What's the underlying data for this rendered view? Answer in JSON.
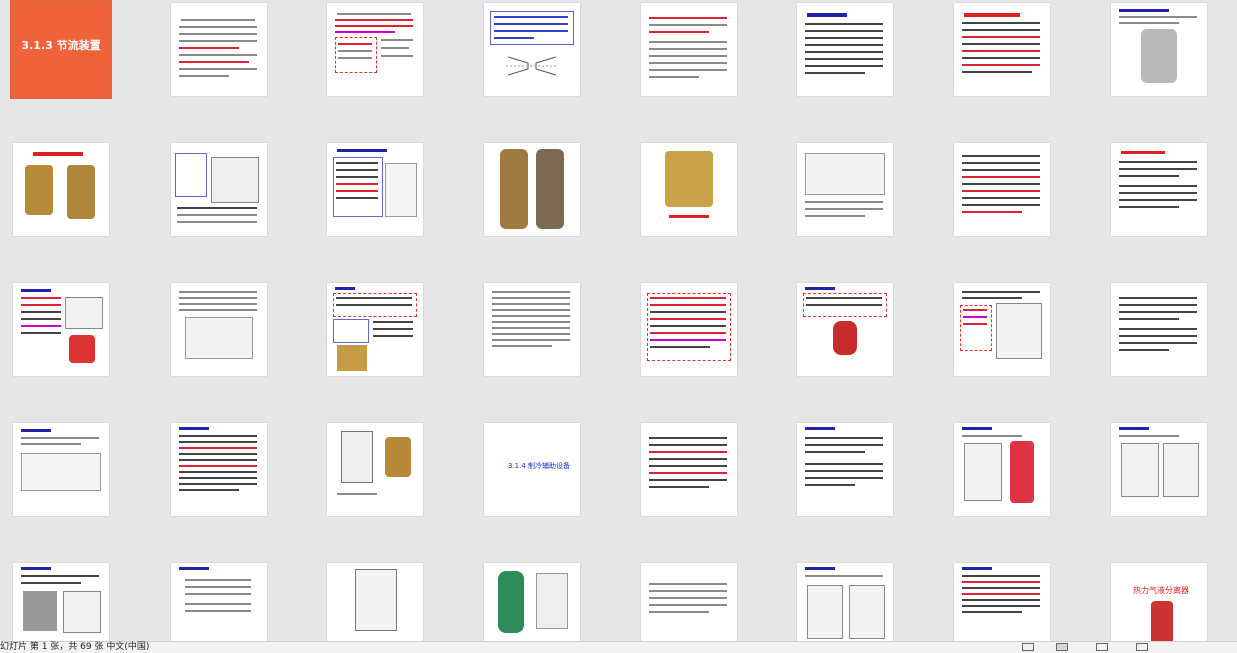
{
  "statusbar": {
    "text": "幻灯片 第 1 张，共 69 张   中文(中国)",
    "language": "中文(中国)"
  },
  "slides": {
    "s1": {
      "title": "3.1.3 节流装置"
    },
    "s8": {
      "title": "3.1.3.1 热力膨胀阀"
    },
    "s27": {
      "title": "3.1.4 制冷辅助设备"
    },
    "s38": {
      "title": "热力气液分离器"
    }
  },
  "colors": {
    "selected": "#e8643a",
    "accent_red": "#d22222",
    "accent_blue": "#2233bb"
  },
  "view_icons": [
    "normal-view-icon",
    "slide-sorter-view-icon",
    "reading-view-icon",
    "slideshow-icon"
  ]
}
